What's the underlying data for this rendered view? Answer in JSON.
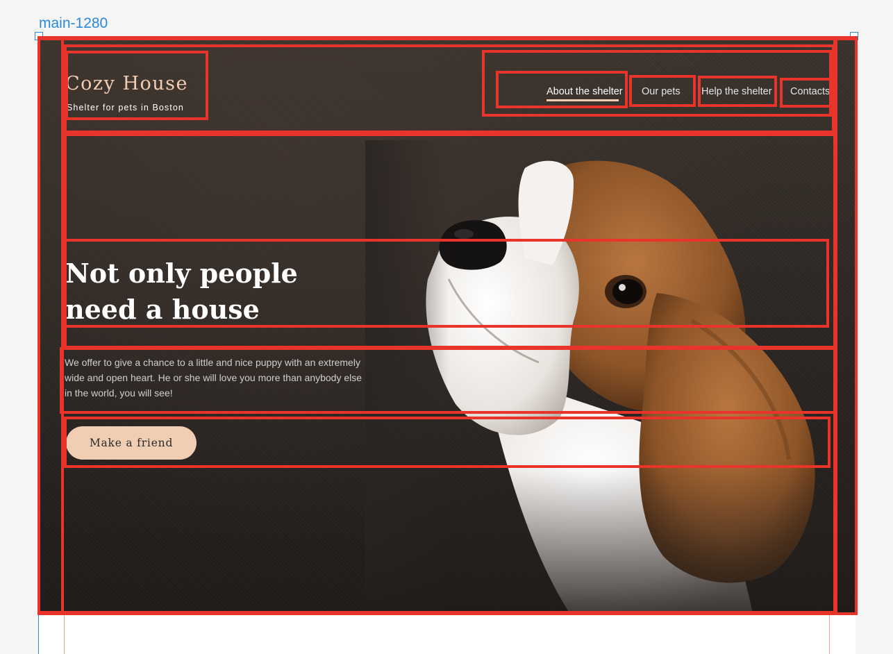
{
  "frame": {
    "label": "main-1280"
  },
  "header": {
    "logo_title": "Cozy House",
    "logo_subtitle": "Shelter for pets in Boston",
    "nav": [
      {
        "label": "About the shelter",
        "active": true
      },
      {
        "label": "Our pets",
        "active": false
      },
      {
        "label": "Help the shelter",
        "active": false
      },
      {
        "label": "Contacts",
        "active": false
      }
    ]
  },
  "hero": {
    "title_line1": "Not only people",
    "title_line2": "need a house",
    "text": "We offer to give a chance to a little and nice puppy with an extremely wide and open heart. He or she will love you more than anybody else in the world, you will see!",
    "button_label": "Make a friend"
  },
  "colors": {
    "accent": "#f1cdb3",
    "annotation": "#e8342a",
    "selection": "#2b8ad8",
    "background": "#2a2523"
  }
}
